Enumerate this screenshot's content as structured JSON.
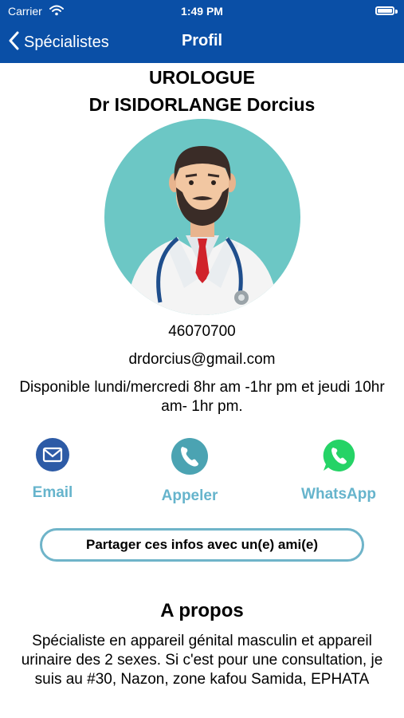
{
  "status_bar": {
    "carrier": "Carrier",
    "time": "1:49 PM"
  },
  "nav": {
    "back_label": "Spécialistes",
    "title": "Profil"
  },
  "profile": {
    "specialty": "UROLOGUE",
    "name": "Dr ISIDORLANGE Dorcius",
    "phone": "46070700",
    "email": "drdorcius@gmail.com",
    "availability": "Disponible lundi/mercredi 8hr am -1hr pm  et jeudi 10hr am- 1hr pm."
  },
  "actions": {
    "email_label": "Email",
    "call_label": "Appeler",
    "whatsapp_label": "WhatsApp",
    "share_label": "Partager ces infos avec un(e) ami(e)"
  },
  "about": {
    "title": "A propos",
    "text": "Spécialiste en appareil génital masculin et appareil urinaire des 2 sexes. Si c'est pour une consultation, je suis au #30, Nazon, zone kafou Samida, EPHATA"
  },
  "colors": {
    "header": "#0A4FA6",
    "accent": "#66B4CC",
    "avatar_bg": "#6CC7C5",
    "whatsapp": "#25D366",
    "email_icon": "#2D5BA6"
  },
  "icons": {
    "back": "chevron-left-icon",
    "wifi": "wifi-icon",
    "battery": "battery-icon",
    "email": "envelope-icon",
    "call": "phone-icon",
    "whatsapp": "whatsapp-icon"
  }
}
